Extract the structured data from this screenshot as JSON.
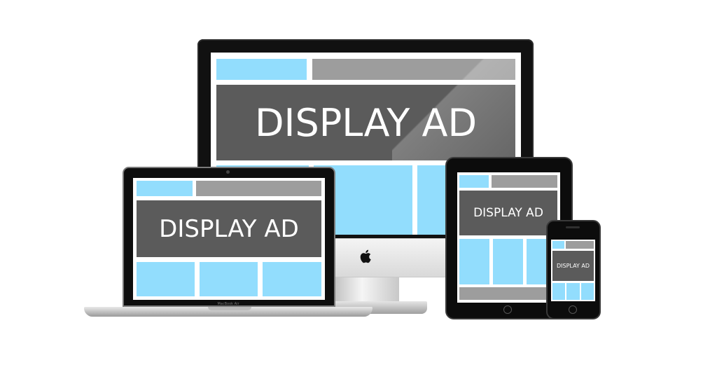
{
  "ad_text": "DISPLAY AD",
  "laptop_model_label": "MacBook Air",
  "colors": {
    "placeholder_blue": "#92ddfd",
    "placeholder_grey": "#9d9d9d",
    "ad_banner_dark": "#5b5b5b",
    "device_black": "#111111",
    "background": "#ffffff"
  },
  "icons": {
    "imac_logo": "apple-logo-icon"
  }
}
